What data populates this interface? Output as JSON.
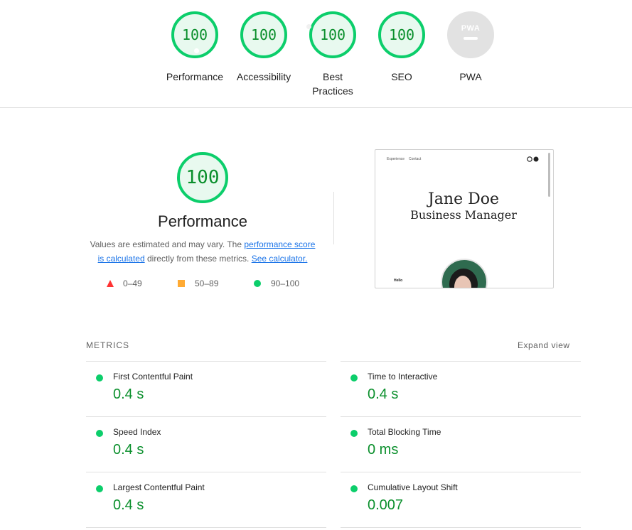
{
  "gauges": [
    {
      "label": "Performance",
      "score": "100"
    },
    {
      "label": "Accessibility",
      "score": "100"
    },
    {
      "label": "Best Practices",
      "score": "100"
    },
    {
      "label": "SEO",
      "score": "100"
    },
    {
      "label": "PWA",
      "score": "PWA"
    }
  ],
  "performance": {
    "score": "100",
    "title": "Performance",
    "desc_prefix": "Values are estimated and may vary. The ",
    "link_score": "performance score is calculated",
    "desc_middle": " directly from these metrics. ",
    "link_calc": "See calculator.",
    "legend": [
      "0–49",
      "50–89",
      "90–100"
    ]
  },
  "screenshot": {
    "nav": [
      "Experience",
      "Contact"
    ],
    "name": "Jane Doe",
    "role": "Business Manager",
    "hello": "Hello"
  },
  "metrics": {
    "heading": "METRICS",
    "expand": "Expand view",
    "items": [
      {
        "label": "First Contentful Paint",
        "value": "0.4 s"
      },
      {
        "label": "Time to Interactive",
        "value": "0.4 s"
      },
      {
        "label": "Speed Index",
        "value": "0.4 s"
      },
      {
        "label": "Total Blocking Time",
        "value": "0 ms"
      },
      {
        "label": "Largest Contentful Paint",
        "value": "0.4 s"
      },
      {
        "label": "Cumulative Layout Shift",
        "value": "0.007"
      }
    ]
  },
  "colors": {
    "pass": "#0cce6b",
    "pass_text": "#0a8f2c",
    "average": "#ffaa33",
    "fail": "#ff3333",
    "link": "#1a73e8"
  }
}
